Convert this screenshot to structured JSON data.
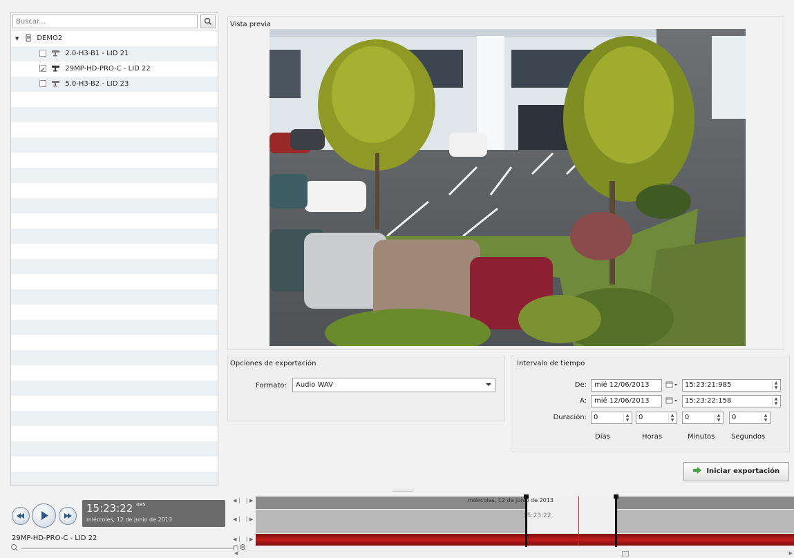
{
  "search": {
    "placeholder": "Buscar..."
  },
  "tree": {
    "root_label": "DEMO2",
    "items": [
      {
        "label": "2.0-H3-B1 - LID 21",
        "checked": false
      },
      {
        "label": "29MP-HD-PRO-C - LID 22",
        "checked": true
      },
      {
        "label": "5.0-H3-B2 - LID 23",
        "checked": false
      }
    ]
  },
  "preview": {
    "label": "Vista previa"
  },
  "export_options": {
    "title": "Opciones de exportación",
    "format_label": "Formato:",
    "format_value": "Audio WAV"
  },
  "time_range": {
    "title": "Intervalo de tiempo",
    "from_label": "De:",
    "from_date": "mié 12/06/2013",
    "from_time": "15:23:21:985",
    "to_label": "A:",
    "to_date": "mié 12/06/2013",
    "to_time": "15:23:22:158",
    "duration_label": "Duración:",
    "days": "0",
    "hours": "0",
    "minutes": "0",
    "seconds": "0",
    "days_label": "Días",
    "hours_label": "Horas",
    "minutes_label": "Minutos",
    "seconds_label": "Segundos"
  },
  "start_export_label": "Iniciar exportación",
  "playback": {
    "time": "15:23:22",
    "ms": "085",
    "date": "miércoles, 12 de junio de 2013"
  },
  "camera_name": "29MP-HD-PRO-C - LID 22",
  "timeline": {
    "date": "miércoles, 12 de junio de 2013",
    "time": "15:23:22"
  },
  "colors": {
    "accent_green": "#3aa83a",
    "timeline_red": "#c21c1c",
    "time_display_bg": "#6b6b6b"
  }
}
